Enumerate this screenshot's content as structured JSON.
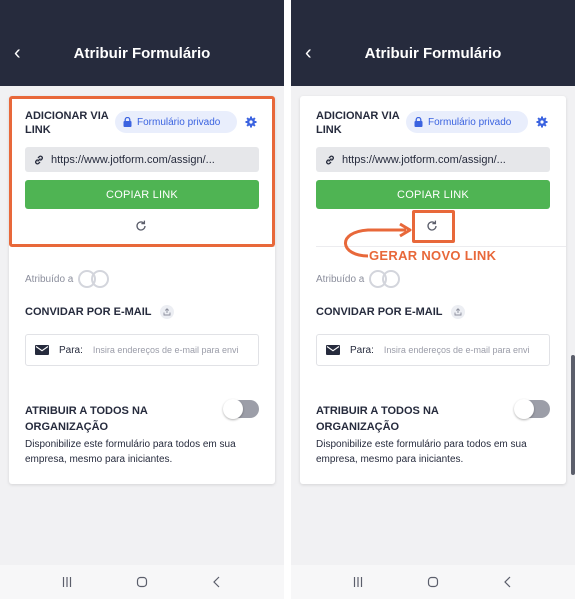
{
  "screens": [
    {
      "header": {
        "back_icon": "chevron-left-icon",
        "title": "Atribuir Formulário"
      },
      "link_section": {
        "title": "ADICIONAR VIA LINK",
        "privacy_badge": "Formulário privado",
        "link_url": "https://www.jotform.com/assign/...",
        "copy_button": "COPIAR LINK"
      },
      "assigned_label": "Atribuído a",
      "invite": {
        "title": "CONVIDAR POR E-MAIL",
        "to_label": "Para:",
        "placeholder": "Insira endereços de e-mail para envi"
      },
      "org": {
        "title": "ATRIBUIR A TODOS NA ORGANIZAÇÃO",
        "description": "Disponibilize este formulário para todos em sua empresa, mesmo para iniciantes.",
        "toggle_on": false
      }
    },
    {
      "header": {
        "back_icon": "chevron-left-icon",
        "title": "Atribuir Formulário"
      },
      "link_section": {
        "title": "ADICIONAR VIA LINK",
        "privacy_badge": "Formulário privado",
        "link_url": "https://www.jotform.com/assign/...",
        "copy_button": "COPIAR LINK"
      },
      "assigned_label": "Atribuído a",
      "invite": {
        "title": "CONVIDAR POR E-MAIL",
        "to_label": "Para:",
        "placeholder": "Insira endereços de e-mail para envi"
      },
      "org": {
        "title": "ATRIBUIR A TODOS NA ORGANIZAÇÃO",
        "description": "Disponibilize este formulário para todos em sua empresa, mesmo para iniciantes.",
        "toggle_on": false
      }
    }
  ],
  "annotation": {
    "text": "GERAR NOVO LINK"
  },
  "colors": {
    "header_bg": "#262b3d",
    "accent_green": "#4fb453",
    "accent_blue": "#3b63e0",
    "highlight_orange": "#e8683a"
  }
}
